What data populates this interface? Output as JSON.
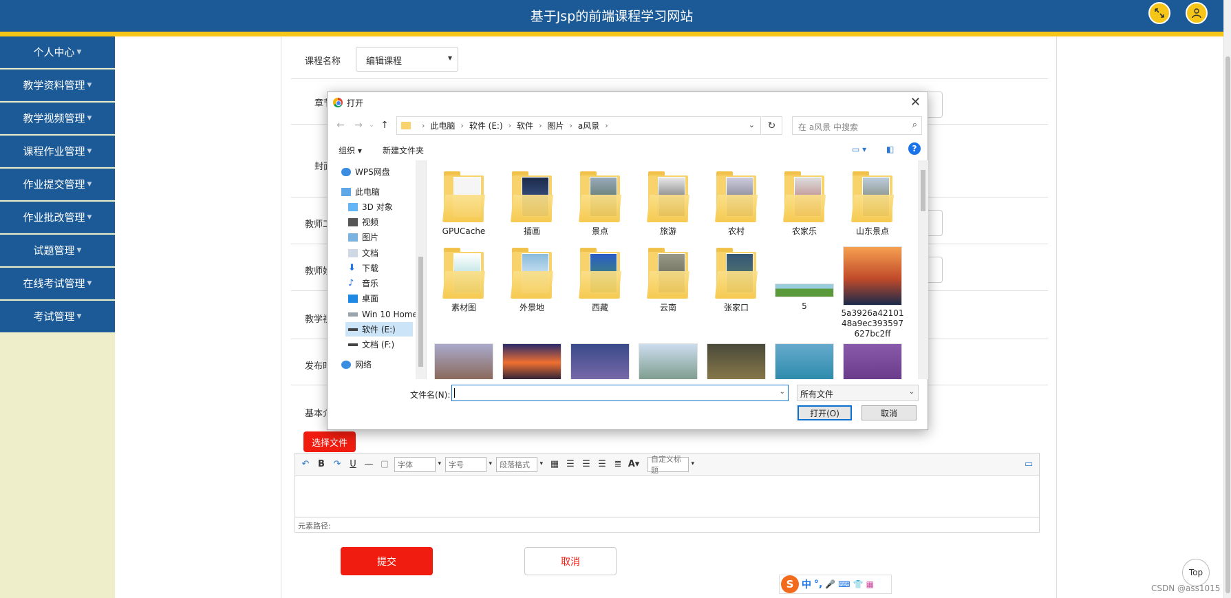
{
  "header": {
    "title": "基于Jsp的前端课程学习网站"
  },
  "sidebar": {
    "items": [
      {
        "label": "个人中心"
      },
      {
        "label": "教学资料管理"
      },
      {
        "label": "教学视频管理"
      },
      {
        "label": "课程作业管理"
      },
      {
        "label": "作业提交管理"
      },
      {
        "label": "作业批改管理"
      },
      {
        "label": "试题管理"
      },
      {
        "label": "在线考试管理"
      },
      {
        "label": "考试管理"
      }
    ]
  },
  "form": {
    "course_label": "课程名称",
    "course_value": "编辑课程",
    "labels": [
      "章节",
      "封面",
      "教师工",
      "教师姓",
      "教学视",
      "发布时",
      "基本介"
    ],
    "choose_file": "选择文件",
    "submit": "提交",
    "cancel": "取消"
  },
  "editor": {
    "combos": [
      "字体",
      "字号",
      "段落格式",
      "自定义标题"
    ],
    "status": "元素路径:"
  },
  "dialog": {
    "title": "打开",
    "breadcrumb": [
      "此电脑",
      "软件 (E:)",
      "软件",
      "图片",
      "a风景"
    ],
    "search_placeholder": "在 a风景 中搜索",
    "organize": "组织 ▾",
    "new_folder": "新建文件夹",
    "nav_items": [
      {
        "label": "WPS网盘",
        "icon": "cloud-icon"
      },
      {
        "label": "此电脑",
        "icon": "computer-icon"
      },
      {
        "label": "3D 对象",
        "icon": "cube-icon"
      },
      {
        "label": "视频",
        "icon": "video-icon"
      },
      {
        "label": "图片",
        "icon": "image-icon"
      },
      {
        "label": "文档",
        "icon": "document-icon"
      },
      {
        "label": "下载",
        "icon": "download-icon"
      },
      {
        "label": "音乐",
        "icon": "music-icon"
      },
      {
        "label": "桌面",
        "icon": "desktop-icon"
      },
      {
        "label": "Win 10 Home",
        "icon": "drive-icon"
      },
      {
        "label": "软件 (E:)",
        "icon": "drive-icon"
      },
      {
        "label": "文档 (F:)",
        "icon": "drive-icon"
      },
      {
        "label": "网络",
        "icon": "network-icon"
      }
    ],
    "folders": [
      "GPUCache",
      "插画",
      "景点",
      "旅游",
      "农村",
      "农家乐",
      "山东景点",
      "素材图",
      "外景地",
      "西藏",
      "云南",
      "张家口"
    ],
    "images": [
      "5",
      "5a3926a4210148a9ec393597627bc2ff"
    ],
    "filename_label": "文件名(N):",
    "filename_value": "",
    "filetype": "所有文件",
    "open": "打开(O)",
    "cancel": "取消"
  },
  "ime": {
    "items": [
      "中",
      "°,",
      "🎤",
      "⌨",
      "👕",
      "▦"
    ]
  },
  "top_button": "Top",
  "watermark": "CSDN @ass1015",
  "colors": {
    "header": "#1b5a96",
    "accent": "#f5c518",
    "danger": "#f01c10",
    "sidebar_bg": "#eeeeca"
  }
}
